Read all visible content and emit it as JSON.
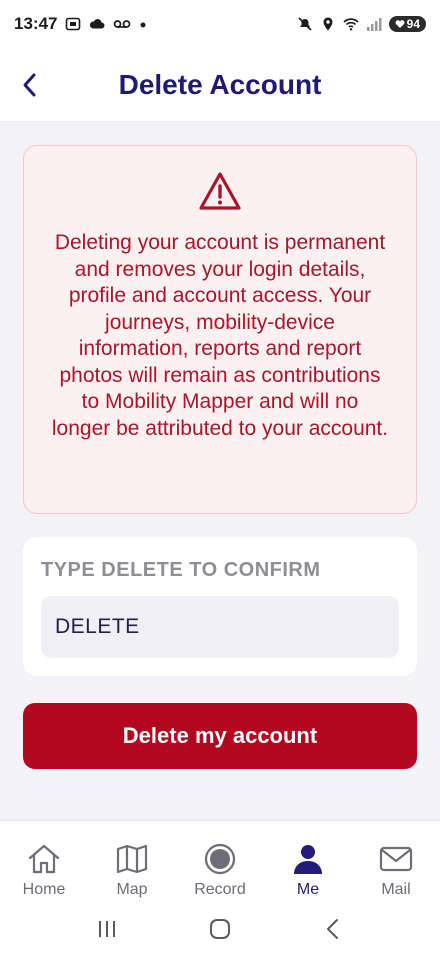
{
  "status_bar": {
    "time": "13:47",
    "battery": "94"
  },
  "header": {
    "title": "Delete Account"
  },
  "warning": {
    "message": "Deleting your account is permanent and removes your login details, profile and account access. Your journeys, mobility-device information, reports and report photos will remain as contributions to Mobility Mapper and will no longer be attributed to your account."
  },
  "confirm": {
    "label": "TYPE DELETE TO CONFIRM",
    "value": "DELETE"
  },
  "actions": {
    "delete_label": "Delete my account"
  },
  "tabs": [
    {
      "label": "Home",
      "icon": "home-icon",
      "active": false
    },
    {
      "label": "Map",
      "icon": "map-icon",
      "active": false
    },
    {
      "label": "Record",
      "icon": "record-icon",
      "active": false
    },
    {
      "label": "Me",
      "icon": "person-icon",
      "active": true
    },
    {
      "label": "Mail",
      "icon": "mail-icon",
      "active": false
    }
  ],
  "colors": {
    "brand": "#1f1a74",
    "danger": "#b3061f",
    "warning_text": "#a8162c",
    "warning_bg": "#fdf0f1"
  }
}
